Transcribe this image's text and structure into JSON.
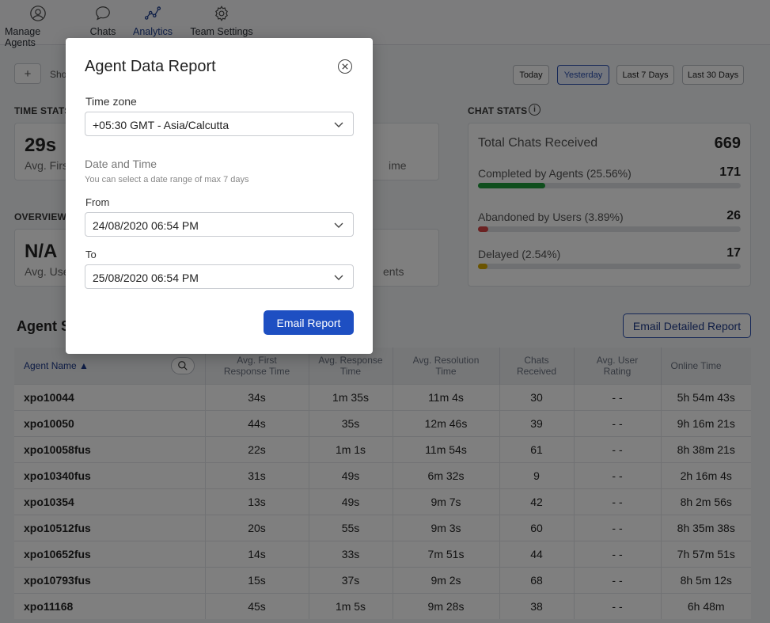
{
  "nav": {
    "items": [
      {
        "label": "Manage Agents",
        "icon": "user-circle-icon"
      },
      {
        "label": "Chats",
        "icon": "chat-bubble-icon"
      },
      {
        "label": "Analytics",
        "icon": "analytics-icon",
        "active": true
      },
      {
        "label": "Team Settings",
        "icon": "gear-icon"
      }
    ]
  },
  "toolbar": {
    "add_label": "+",
    "show_label": "Sho",
    "ranges": [
      {
        "label": "Today"
      },
      {
        "label": "Yesterday",
        "active": true
      },
      {
        "label": "Last 7 Days"
      },
      {
        "label": "Last 30 Days"
      }
    ]
  },
  "time_stats": {
    "title": "TIME STATS",
    "value": "29s",
    "label": "Avg. Firs",
    "label_right": "ime"
  },
  "overview": {
    "title": "OVERVIEW",
    "value": "N/A",
    "label": "Avg. Use",
    "label_right": "ents"
  },
  "chat_stats": {
    "title": "CHAT STATS",
    "info_glyph": "i",
    "total_label": "Total Chats Received",
    "total_value": "669",
    "rows": [
      {
        "label": "Completed by Agents (25.56%)",
        "value": "171",
        "fraction": 0.2556,
        "color": "#1f9d3a"
      },
      {
        "label": "Abandoned by Users (3.89%)",
        "value": "26",
        "fraction": 0.0389,
        "color": "#d64545"
      },
      {
        "label": "Delayed (2.54%)",
        "value": "17",
        "fraction": 0.0254,
        "color": "#d6a800"
      }
    ]
  },
  "agent_section": {
    "title": "Agent S",
    "email_detailed_label": "Email Detailed Report"
  },
  "table": {
    "headers": [
      "Agent Name ▲",
      "Avg. First\nResponse Time",
      "Avg. Response\nTime",
      "Avg. Resolution\nTime",
      "Chats\nReceived",
      "Avg. User\nRating",
      "Online Time"
    ],
    "rows": [
      [
        "xpo10044",
        "34s",
        "1m 35s",
        "11m 4s",
        "30",
        "- -",
        "5h 54m 43s"
      ],
      [
        "xpo10050",
        "44s",
        "35s",
        "12m 46s",
        "39",
        "- -",
        "9h 16m 21s"
      ],
      [
        "xpo10058fus",
        "22s",
        "1m 1s",
        "11m 54s",
        "61",
        "- -",
        "8h 38m 21s"
      ],
      [
        "xpo10340fus",
        "31s",
        "49s",
        "6m 32s",
        "9",
        "- -",
        "2h 16m 4s"
      ],
      [
        "xpo10354",
        "13s",
        "49s",
        "9m 7s",
        "42",
        "- -",
        "8h 2m 56s"
      ],
      [
        "xpo10512fus",
        "20s",
        "55s",
        "9m 3s",
        "60",
        "- -",
        "8h 35m 38s"
      ],
      [
        "xpo10652fus",
        "14s",
        "33s",
        "7m 51s",
        "44",
        "- -",
        "7h 57m 51s"
      ],
      [
        "xpo10793fus",
        "15s",
        "37s",
        "9m 2s",
        "68",
        "- -",
        "8h 5m 12s"
      ],
      [
        "xpo11168",
        "45s",
        "1m 5s",
        "9m 28s",
        "38",
        "- -",
        "6h 48m"
      ]
    ]
  },
  "modal": {
    "title": "Agent Data Report",
    "timezone_label": "Time zone",
    "timezone_value": "+05:30 GMT - Asia/Calcutta",
    "datetime_title": "Date and Time",
    "datetime_sub": "You can select a date range of max 7 days",
    "from_label": "From",
    "from_value": "24/08/2020 06:54 PM",
    "to_label": "To",
    "to_value": "25/08/2020 06:54 PM",
    "email_label": "Email Report"
  }
}
